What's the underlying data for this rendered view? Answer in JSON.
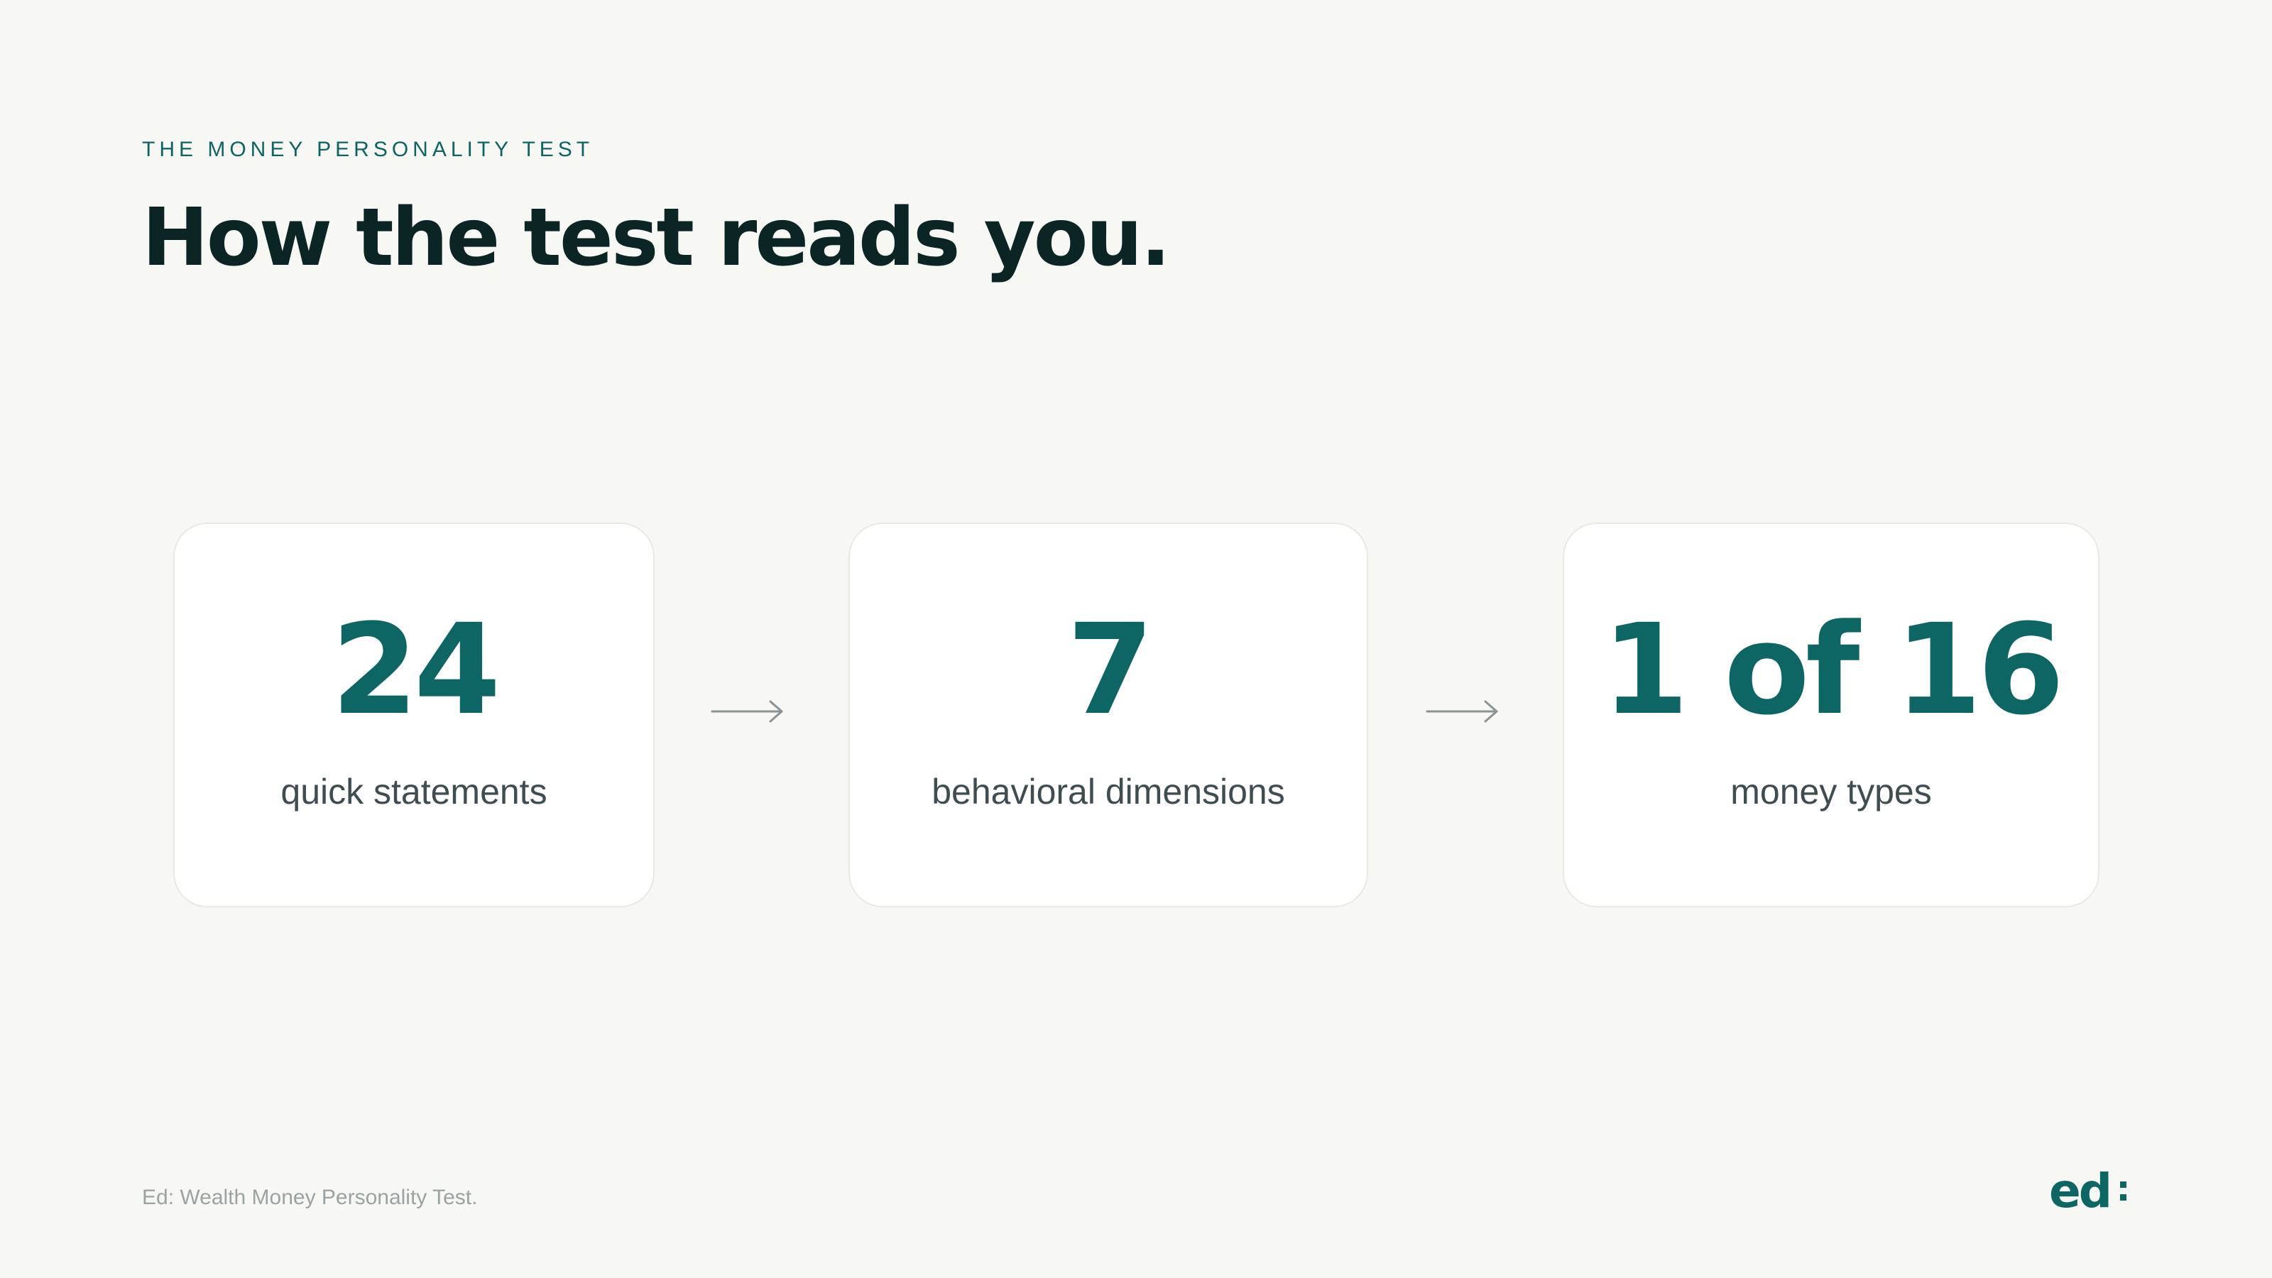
{
  "header": {
    "eyebrow": "THE MONEY PERSONALITY TEST",
    "title": "How the test reads you."
  },
  "steps": [
    {
      "value": "24",
      "label": "quick statements"
    },
    {
      "value": "7",
      "label": "behavioral dimensions"
    },
    {
      "value": "1 of 16",
      "label": "money types"
    }
  ],
  "footer": {
    "source": "Ed: Wealth Money Personality Test.",
    "logo_text": "ed"
  },
  "colors": {
    "background": "#f7f7f4",
    "accent_teal": "#0d6564",
    "title_dark": "#0b2424",
    "muted_text": "#3f4d52",
    "arrow_gray": "#8a9494"
  },
  "icons": [
    "arrow-right-icon",
    "brand-logo-icon"
  ]
}
